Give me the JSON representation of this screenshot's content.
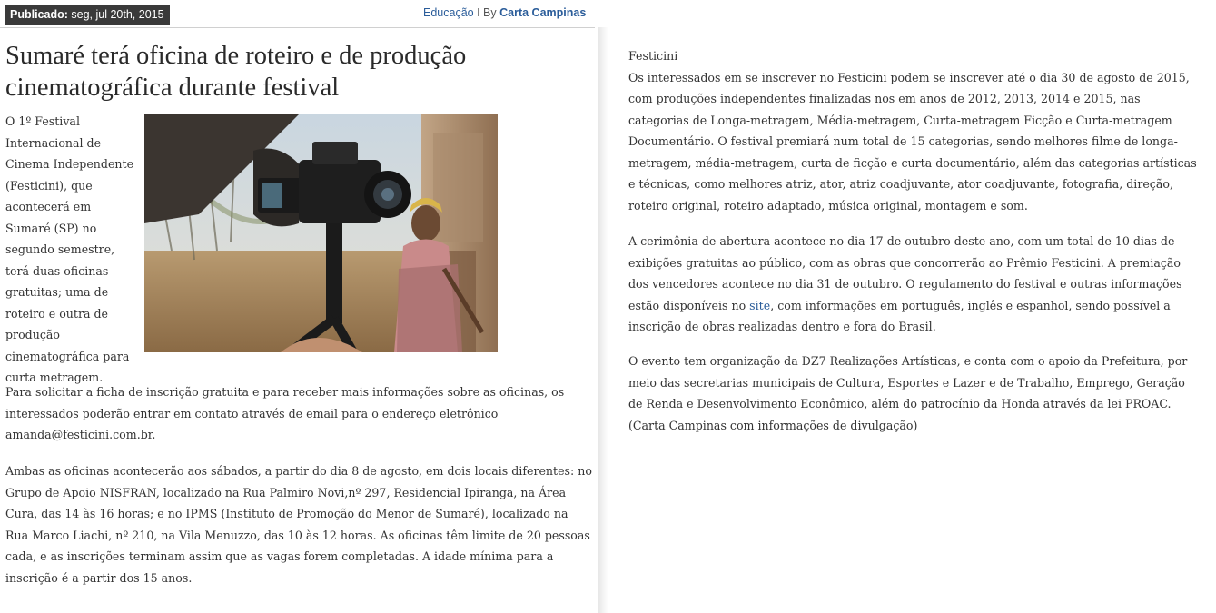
{
  "meta": {
    "published_label": "Publicado:",
    "published_date": "seg, jul 20th, 2015",
    "category": "Educação",
    "separator": "I By",
    "author": "Carta Campinas"
  },
  "article": {
    "title": "Sumaré terá oficina de roteiro e de produção cinematográfica durante festival",
    "intro": "O 1º Festival Internacional de Cinema Independente (Festicini), que acontecerá em Sumaré (SP) no segundo semestre, terá duas oficinas gratuitas; uma de roteiro e outra de produção cinematográfica para curta metragem.",
    "para2": "Para solicitar a ficha de inscrição gratuita e para receber mais informações sobre as oficinas, os interessados poderão entrar em contato através de email para o endereço eletrônico amanda@festicini.com.br.",
    "para3": "Ambas as oficinas acontecerão aos sábados, a partir do dia 8 de agosto, em dois locais diferentes: no Grupo de Apoio NISFRAN, localizado na Rua Palmiro Novi,nº 297, Residencial Ipiranga, na Área Cura, das 14 às 16 horas; e no IPMS (Instituto de Promoção do Menor de Sumaré), localizado na Rua Marco Liachi, nº 210, na Vila Menuzzo, das 10 às 12 horas. As oficinas têm limite de 20 pessoas cada, e as inscrições terminam assim que as vagas forem completadas. A idade mínima para a inscrição é a partir dos 15 anos."
  },
  "continuation": {
    "heading": "Festicini",
    "para1": "Os interessados em se inscrever no Festicini podem se inscrever até o dia 30 de agosto de 2015, com produções independentes finalizadas nos em anos de 2012, 2013, 2014 e 2015, nas categorias de Longa-metragem, Média-metragem, Curta-metragem Ficção e Curta-metragem Documentário. O festival premiará num total de 15 categorias, sendo melhores filme de longa-metragem, média-metragem, curta de ficção e curta documentário, além das categorias artísticas e técnicas, como melhores atriz, ator, atriz coadjuvante, ator coadjuvante, fotografia, direção, roteiro original, roteiro adaptado, música original, montagem e som.",
    "para2_before": "A cerimônia de abertura acontece no dia 17 de outubro deste ano, com um total de 10 dias de exibições gratuitas ao público, com as obras que concorrerão ao Prêmio Festicini. A premiação dos vencedores acontece no dia 31 de outubro. O regulamento do festival e outras informações estão disponíveis no ",
    "para2_link": "site",
    "para2_after": ", com informações em português, inglês e espanhol, sendo possível a inscrição de obras realizadas dentro e fora do Brasil.",
    "para3": "O evento tem organização da DZ7 Realizações Artísticas, e conta com o apoio da Prefeitura, por meio das secretarias municipais de Cultura, Esportes e Lazer e de Trabalho, Emprego, Geração de Renda e Desenvolvimento Econômico, além do patrocínio da Honda através da lei PROAC. (Carta Campinas com informações de divulgação)"
  },
  "photo": {
    "icon": "film-camera-photo"
  }
}
